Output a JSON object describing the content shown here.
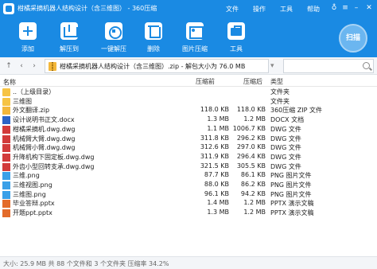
{
  "window": {
    "title": "柑橘采摘机器人结构设计（含三维图） - 360压缩",
    "menus": [
      "文件",
      "操作",
      "工具",
      "帮助"
    ]
  },
  "toolbar": {
    "items": [
      {
        "label": "添加",
        "icon": "add-icon"
      },
      {
        "label": "解压到",
        "icon": "extract-icon"
      },
      {
        "label": "一键解压",
        "icon": "onekey-extract-icon"
      },
      {
        "label": "删除",
        "icon": "delete-icon"
      },
      {
        "label": "图片压缩",
        "icon": "image-compress-icon"
      },
      {
        "label": "工具",
        "icon": "toolbox-icon"
      }
    ],
    "scan_label": "扫描"
  },
  "address": {
    "path": "柑橘采摘机器人结构设计（含三维图）.zip - 解包大小为 76.0 MB",
    "dropdown_glyph": "V"
  },
  "columns": {
    "name": "名称",
    "size": "压缩前",
    "packed": "压缩后",
    "type": "类型"
  },
  "files": [
    {
      "name": "..（上级目录）",
      "size": "",
      "packed": "",
      "type": "文件夹",
      "kind": "folder"
    },
    {
      "name": "三维图",
      "size": "",
      "packed": "",
      "type": "文件夹",
      "kind": "folder"
    },
    {
      "name": "外文翻译.zip",
      "size": "118.0 KB",
      "packed": "118.0 KB",
      "type": "360压缩 ZIP 文件",
      "kind": "zip"
    },
    {
      "name": "设计说明书正文.docx",
      "size": "1.3 MB",
      "packed": "1.2 MB",
      "type": "DOCX 文档",
      "kind": "docx"
    },
    {
      "name": "柑橘采摘机.dwg.dwg",
      "size": "1.1 MB",
      "packed": "1006.7 KB",
      "type": "DWG 文件",
      "kind": "dwg"
    },
    {
      "name": "机械臂大臂.dwg.dwg",
      "size": "311.8 KB",
      "packed": "296.2 KB",
      "type": "DWG 文件",
      "kind": "dwg"
    },
    {
      "name": "机械臂小臂.dwg.dwg",
      "size": "312.6 KB",
      "packed": "297.0 KB",
      "type": "DWG 文件",
      "kind": "dwg"
    },
    {
      "name": "升降机构下固定板.dwg.dwg",
      "size": "311.9 KB",
      "packed": "296.4 KB",
      "type": "DWG 文件",
      "kind": "dwg"
    },
    {
      "name": "外齿小型回转支承.dwg.dwg",
      "size": "321.5 KB",
      "packed": "305.5 KB",
      "type": "DWG 文件",
      "kind": "dwg"
    },
    {
      "name": "三维.png",
      "size": "87.7 KB",
      "packed": "86.1 KB",
      "type": "PNG 图片文件",
      "kind": "png"
    },
    {
      "name": "三维视图.png",
      "size": "88.0 KB",
      "packed": "86.2 KB",
      "type": "PNG 图片文件",
      "kind": "png"
    },
    {
      "name": "三维图.png",
      "size": "96.1 KB",
      "packed": "94.2 KB",
      "type": "PNG 图片文件",
      "kind": "png"
    },
    {
      "name": "毕业答辩.pptx",
      "size": "1.4 MB",
      "packed": "1.2 MB",
      "type": "PPTX 演示文稿",
      "kind": "pptx"
    },
    {
      "name": "开题ppt.pptx",
      "size": "1.3 MB",
      "packed": "1.2 MB",
      "type": "PPTX 演示文稿",
      "kind": "pptx"
    }
  ],
  "status": {
    "text": "大小: 25.9 MB 共 88 个文件和 3 个文件夹 压缩率 34.2%"
  }
}
